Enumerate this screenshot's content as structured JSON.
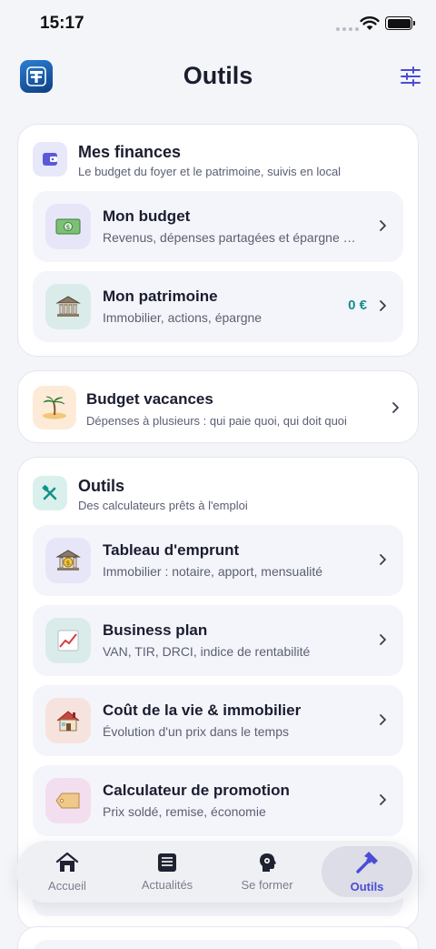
{
  "status_bar": {
    "time": "15:17"
  },
  "header": {
    "title": "Outils"
  },
  "finances": {
    "title": "Mes finances",
    "subtitle": "Le budget du foyer et le patrimoine, suivis en local",
    "items": [
      {
        "title": "Mon budget",
        "subtitle": "Revenus, dépenses partagées et épargne …",
        "icon": "money-icon"
      },
      {
        "title": "Mon patrimoine",
        "subtitle": "Immobilier, actions, épargne",
        "value": "0 €",
        "icon": "bank-icon"
      }
    ]
  },
  "vacation": {
    "title": "Budget vacances",
    "subtitle": "Dépenses à plusieurs : qui paie quoi, qui doit quoi",
    "icon": "island-icon"
  },
  "tools": {
    "title": "Outils",
    "subtitle": "Des calculateurs prêts à l'emploi",
    "items": [
      {
        "title": "Tableau d'emprunt",
        "subtitle": "Immobilier : notaire, apport, mensualité",
        "icon": "bank-loan-icon"
      },
      {
        "title": "Business plan",
        "subtitle": "VAN, TIR, DRCI, indice de rentabilité",
        "icon": "chart-up-icon"
      },
      {
        "title": "Coût de la vie & immobilier",
        "subtitle": "Évolution d'un prix dans le temps",
        "icon": "house-icon"
      },
      {
        "title": "Calculateur de promotion",
        "subtitle": "Prix soldé, remise, économie",
        "icon": "tag-icon"
      }
    ]
  },
  "tab_bar": {
    "tabs": [
      {
        "label": "Accueil",
        "icon": "home-icon"
      },
      {
        "label": "Actualités",
        "icon": "news-icon"
      },
      {
        "label": "Se former",
        "icon": "learn-icon"
      },
      {
        "label": "Outils",
        "icon": "hammer-icon",
        "active": true
      }
    ]
  },
  "colors": {
    "accent": "#4b4bd6",
    "teal": "#14918a",
    "background": "#f4f5f9"
  }
}
